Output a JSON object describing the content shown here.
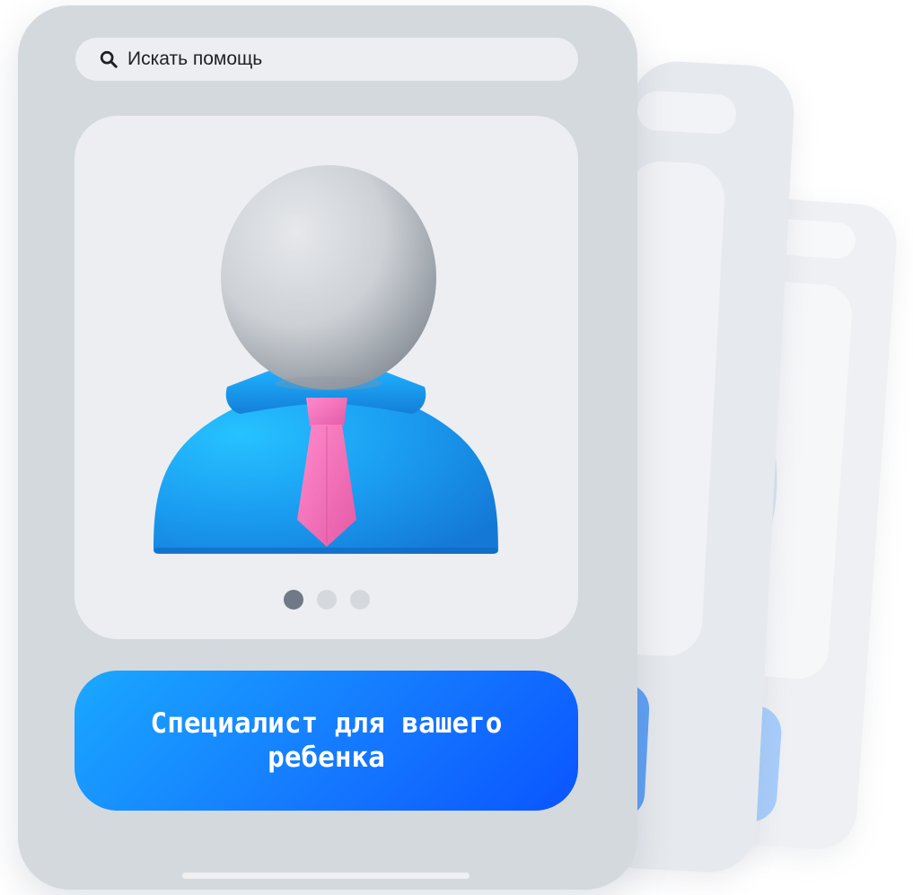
{
  "search": {
    "placeholder": "Искать помощь",
    "icon": "search-icon"
  },
  "carousel": {
    "image_icon": "specialist-avatar-icon",
    "total_slides": 3,
    "active_slide": 1
  },
  "cta": {
    "label": "Специалист для вашего ребенка"
  },
  "colors": {
    "card_background": "#d4d9de",
    "panel_background": "#eceef1",
    "accent_blue": "#1475ff",
    "shirt_blue": "#1a9bf0",
    "tie_pink": "#ee6fb4",
    "dot_active": "#6f7a86",
    "dot_inactive": "#d5d9de"
  }
}
